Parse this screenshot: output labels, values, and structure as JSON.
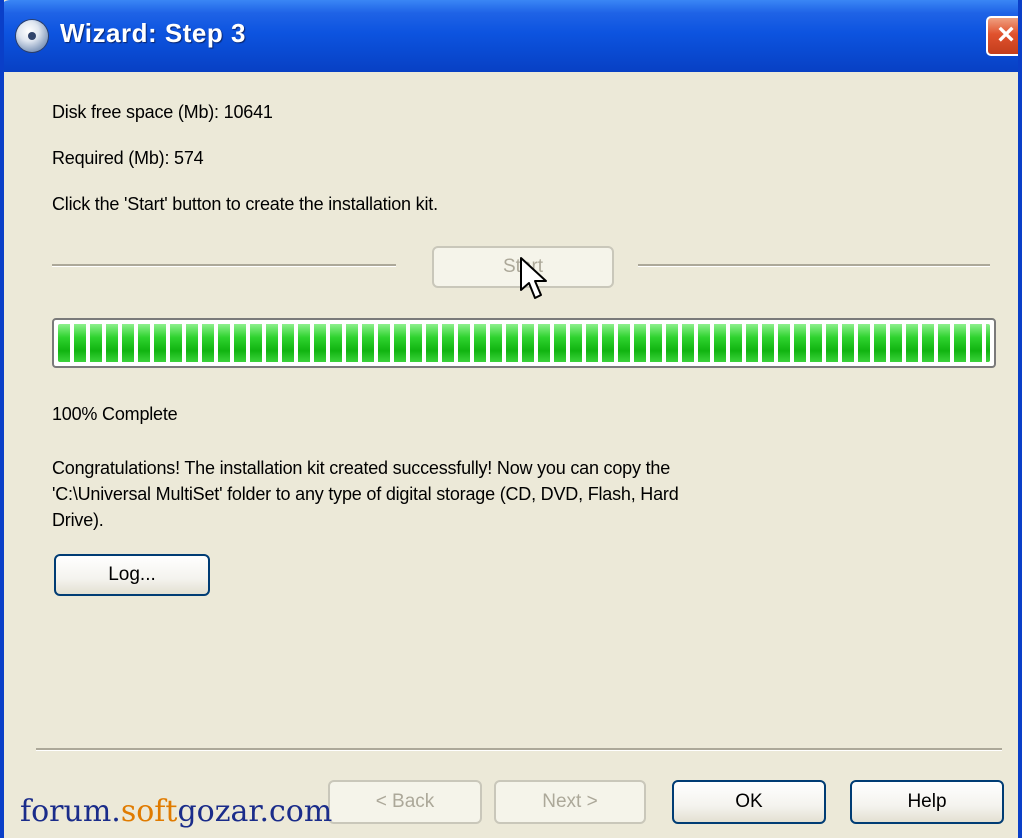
{
  "window": {
    "title": "Wizard: Step 3",
    "close_symbol": "×"
  },
  "info": {
    "disk_free": "Disk free space (Mb): 10641",
    "required": "Required (Mb): 574",
    "instruction": "Click the 'Start' button to create the installation kit."
  },
  "start_button": {
    "label": "Start",
    "enabled": false
  },
  "progress": {
    "value": 1.0,
    "status_text": "100% Complete"
  },
  "result": {
    "line1": "Congratulations! The installation kit created successfully! Now you can copy the",
    "line2": "'C:\\Universal MultiSet' folder to any type of digital storage (CD, DVD, Flash, Hard",
    "line3": "Drive)."
  },
  "log_button": {
    "label": "Log..."
  },
  "footer": {
    "back_label": "< Back",
    "next_label": "Next >",
    "ok_label": "OK",
    "help_label": "Help"
  },
  "watermark": {
    "part1": "forum.",
    "part2": "soft",
    "part3": "gozar.com"
  },
  "colors": {
    "titlebar": "#0a4bd3",
    "progress_green": "#11b411",
    "dialog_bg": "#ece9d8"
  }
}
